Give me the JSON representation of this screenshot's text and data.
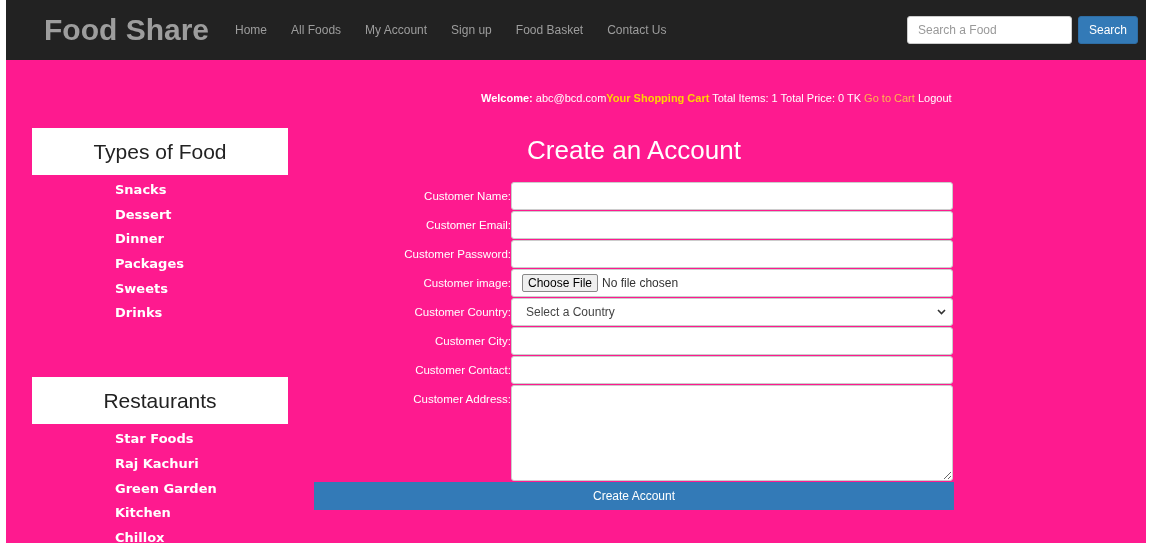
{
  "navbar": {
    "brand": "Food Share",
    "links": [
      "Home",
      "All Foods",
      "My Account",
      "Sign up",
      "Food Basket",
      "Contact Us"
    ],
    "search": {
      "placeholder": "Search a Food",
      "button": "Search"
    }
  },
  "welcome_bar": {
    "welcome_label": "Welcome:",
    "email": "abc@bcd.com",
    "cart_label": "Your Shopping Cart",
    "summary": "Total Items: 1 Total Price: 0 TK",
    "cart_link": "Go to Cart",
    "logout": "Logout"
  },
  "sidebar": [
    {
      "title": "Types of Food",
      "items": [
        "Snacks",
        "Dessert",
        "Dinner",
        "Packages",
        "Sweets",
        "Drinks"
      ]
    },
    {
      "title": "Restaurants",
      "items": [
        "Star Foods",
        "Raj Kachuri",
        "Green Garden",
        "Kitchen",
        "Chillox"
      ]
    }
  ],
  "form": {
    "title": "Create an Account",
    "fields": [
      {
        "label": "Customer Name:",
        "kind": "text"
      },
      {
        "label": "Customer Email:",
        "kind": "text"
      },
      {
        "label": "Customer Password:",
        "kind": "password"
      },
      {
        "label": "Customer image:",
        "kind": "file",
        "button": "Choose File",
        "status": "No file chosen"
      },
      {
        "label": "Customer Country:",
        "kind": "select",
        "value": "Select a Country"
      },
      {
        "label": "Customer City:",
        "kind": "text"
      },
      {
        "label": "Customer Contact:",
        "kind": "text"
      },
      {
        "label": "Customer Address:",
        "kind": "textarea"
      }
    ],
    "submit": "Create Account"
  }
}
